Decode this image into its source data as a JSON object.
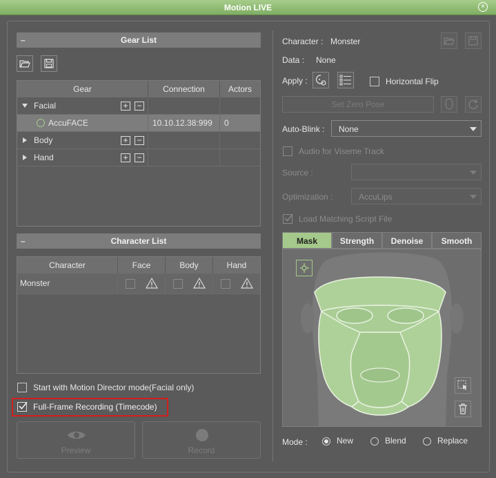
{
  "window": {
    "title": "Motion LIVE"
  },
  "gear_list": {
    "header": "Gear List",
    "columns": [
      "Gear",
      "Connection",
      "Actors"
    ],
    "rows": [
      {
        "name": "Facial",
        "connection": "",
        "actors": ""
      },
      {
        "name": "AccuFACE",
        "connection": "10.10.12.38:999",
        "actors": "0"
      },
      {
        "name": "Body",
        "connection": "",
        "actors": ""
      },
      {
        "name": "Hand",
        "connection": "",
        "actors": ""
      }
    ]
  },
  "character_list": {
    "header": "Character List",
    "columns": [
      "Character",
      "Face",
      "Body",
      "Hand"
    ],
    "rows": [
      {
        "name": "Monster"
      }
    ]
  },
  "options": {
    "motion_director": "Start with Motion Director mode(Facial only)",
    "full_frame": "Full-Frame Recording (Timecode)"
  },
  "buttons": {
    "preview": "Preview",
    "record": "Record"
  },
  "right": {
    "character_label": "Character :",
    "character_value": "Monster",
    "data_label": "Data :",
    "data_value": "None",
    "apply_label": "Apply :",
    "horizontal_flip": "Horizontal Flip",
    "set_zero_pose": "Set Zero Pose",
    "auto_blink_label": "Auto-Blink :",
    "auto_blink_value": "None",
    "audio_viseme": "Audio for Viseme Track",
    "source_label": "Source :",
    "optimization_label": "Optimization :",
    "optimization_value": "AccuLips",
    "load_script": "Load Matching Script File",
    "tabs": [
      "Mask",
      "Strength",
      "Denoise",
      "Smooth"
    ],
    "mode_label": "Mode :",
    "modes": [
      "New",
      "Blend",
      "Replace"
    ]
  },
  "colors": {
    "accent": "#a5c98b",
    "highlight_box": "#d21e1e",
    "panel": "#5a5a5a"
  }
}
